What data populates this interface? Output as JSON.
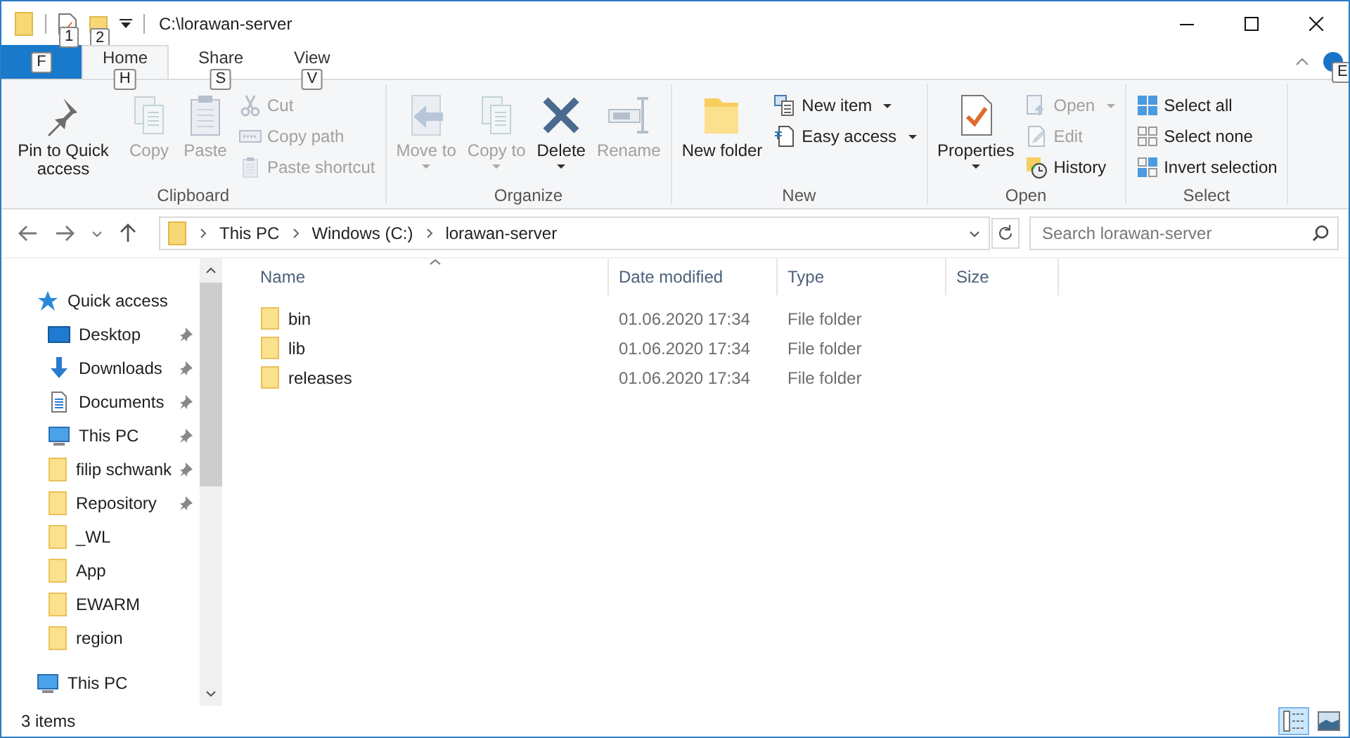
{
  "window": {
    "title": "C:\\lorawan-server",
    "quick_access_keytips": [
      "1",
      "2"
    ]
  },
  "ribbon": {
    "tabs": [
      {
        "kind": "file",
        "keytip": "F",
        "selected": false
      },
      {
        "kind": "tab",
        "label": "Home",
        "keytip": "H",
        "selected": true
      },
      {
        "kind": "tab",
        "label": "Share",
        "keytip": "S",
        "selected": false
      },
      {
        "kind": "tab",
        "label": "View",
        "keytip": "V",
        "selected": false
      }
    ],
    "help_keytip": "E",
    "groups": [
      {
        "label": "Clipboard",
        "items": [
          {
            "kind": "large",
            "label": "Pin to Quick access",
            "disabled": false,
            "dropdown": false
          },
          {
            "kind": "large",
            "label": "Copy",
            "disabled": true,
            "dropdown": false
          },
          {
            "kind": "large",
            "label": "Paste",
            "disabled": true,
            "dropdown": false
          },
          {
            "kind": "small",
            "label": "Cut",
            "disabled": true,
            "dropdown": false
          },
          {
            "kind": "small",
            "label": "Copy path",
            "disabled": true,
            "dropdown": false
          },
          {
            "kind": "small",
            "label": "Paste shortcut",
            "disabled": true,
            "dropdown": false
          }
        ]
      },
      {
        "label": "Organize",
        "items": [
          {
            "kind": "large",
            "label": "Move to",
            "disabled": true,
            "dropdown": true
          },
          {
            "kind": "large",
            "label": "Copy to",
            "disabled": true,
            "dropdown": true
          },
          {
            "kind": "large",
            "label": "Delete",
            "disabled": false,
            "dropdown": true
          },
          {
            "kind": "large",
            "label": "Rename",
            "disabled": true,
            "dropdown": false
          }
        ]
      },
      {
        "label": "New",
        "items": [
          {
            "kind": "large",
            "label": "New folder",
            "disabled": false,
            "dropdown": false
          },
          {
            "kind": "small",
            "label": "New item",
            "disabled": false,
            "dropdown": true
          },
          {
            "kind": "small",
            "label": "Easy access",
            "disabled": false,
            "dropdown": true
          }
        ]
      },
      {
        "label": "Open",
        "items": [
          {
            "kind": "large",
            "label": "Properties",
            "disabled": false,
            "dropdown": true
          },
          {
            "kind": "small",
            "label": "Open",
            "disabled": true,
            "dropdown": true
          },
          {
            "kind": "small",
            "label": "Edit",
            "disabled": true,
            "dropdown": false
          },
          {
            "kind": "small",
            "label": "History",
            "disabled": false,
            "dropdown": false
          }
        ]
      },
      {
        "label": "Select",
        "items": [
          {
            "kind": "small",
            "label": "Select all",
            "disabled": false,
            "dropdown": false
          },
          {
            "kind": "small",
            "label": "Select none",
            "disabled": false,
            "dropdown": false
          },
          {
            "kind": "small",
            "label": "Invert selection",
            "disabled": false,
            "dropdown": false
          }
        ]
      }
    ]
  },
  "address_bar": {
    "path": [
      "This PC",
      "Windows (C:)",
      "lorawan-server"
    ]
  },
  "search": {
    "placeholder": "Search lorawan-server"
  },
  "navigation": {
    "items": [
      {
        "label": "Quick access",
        "kind": "star",
        "children": [
          {
            "label": "Desktop",
            "kind": "desktop",
            "pinned": true
          },
          {
            "label": "Downloads",
            "kind": "download",
            "pinned": true
          },
          {
            "label": "Documents",
            "kind": "documents",
            "pinned": true
          },
          {
            "label": "This PC",
            "kind": "pc",
            "pinned": true
          },
          {
            "label": "filip schwank",
            "kind": "folder",
            "pinned": true
          },
          {
            "label": "Repository",
            "kind": "folder",
            "pinned": true
          },
          {
            "label": "_WL",
            "kind": "folder",
            "pinned": false
          },
          {
            "label": "App",
            "kind": "folder",
            "pinned": false
          },
          {
            "label": "EWARM",
            "kind": "folder",
            "pinned": false
          },
          {
            "label": "region",
            "kind": "folder",
            "pinned": false
          }
        ]
      },
      {
        "label": "This PC",
        "kind": "pc"
      }
    ]
  },
  "table": {
    "columns": [
      {
        "label": "Name",
        "sorted": true
      },
      {
        "label": "Date modified",
        "sorted": false
      },
      {
        "label": "Type",
        "sorted": false
      },
      {
        "label": "Size",
        "sorted": false
      }
    ],
    "rows": [
      {
        "name": "bin",
        "date": "01.06.2020 17:34",
        "type": "File folder"
      },
      {
        "name": "lib",
        "date": "01.06.2020 17:34",
        "type": "File folder"
      },
      {
        "name": "releases",
        "date": "01.06.2020 17:34",
        "type": "File folder"
      }
    ]
  },
  "status_bar": {
    "item_count": "3 items",
    "views": [
      {
        "kind": "details",
        "selected": true
      },
      {
        "kind": "large_icons",
        "selected": false
      }
    ]
  }
}
